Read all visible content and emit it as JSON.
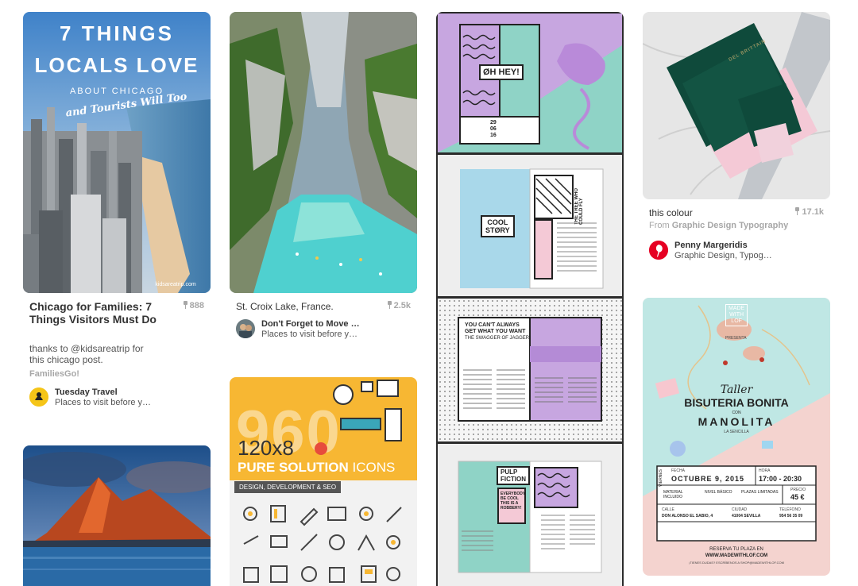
{
  "pins": [
    {
      "image_text": {
        "line1": "7 THINGS",
        "line2": "LOCALS LOVE",
        "line3": "ABOUT CHICAGO",
        "line4": "and Tourists Will Too",
        "credit": "kidsareatrip.com"
      },
      "title": "Chicago for Families: 7 Things Visitors Must Do",
      "saves": "888",
      "description": "thanks to @kidsareatrip for this chicago post.",
      "source": "FamiliesGo!",
      "user": "Tuesday Travel",
      "board": "Places to visit before y…"
    },
    {
      "title": "St. Croix Lake, France.",
      "saves": "2.5k",
      "user": "Don't Forget to Move …",
      "board": "Places to visit before y…"
    },
    {
      "image_text": {
        "big": "960",
        "size": "120x8",
        "line": "PURE SOLUTION",
        "icons": "ICONS",
        "tag": "DESIGN, DEVELOPMENT & SEO"
      }
    },
    {
      "image_text": {
        "hey": "ØH HEY!",
        "date1": "29",
        "date2": "06",
        "date3": "16",
        "cool1": "COOL",
        "cool2": "STØRY",
        "tree": "THE TREE WHO COULD FLY",
        "want1": "YOU CAN'T ALWAYS",
        "want2": "GET WHAT YOU WANT",
        "want3": "THE SWAGGER OF JAGGER",
        "pulp1": "PULP",
        "pulp2": "FICTION",
        "robbery": "EVERYBODY BE COOL THIS IS A ROBBERY!"
      }
    },
    {
      "image_text": {
        "brand": "DEL BRITTAIN"
      },
      "title": "this colour",
      "saves": "17.1k",
      "source_prefix": "From",
      "source": "Graphic Design Typography",
      "user": "Penny Margeridis",
      "board": "Graphic Design, Typog…"
    },
    {
      "image_text": {
        "made1": "MADE",
        "made2": "WITH",
        "made3": "LOF",
        "presenta": "PRESENTA",
        "taller": "Taller",
        "bisuteria": "BISUTERIA BONITA",
        "con": "CON",
        "manolita": "MANOLITA",
        "sencilla": "LA SENCILLA",
        "viernes": "VIERNES",
        "fecha_label": "FECHA",
        "fecha": "OCTUBRE 9, 2015",
        "hora_label": "HORA",
        "hora": "17:00 - 20:30",
        "material": "MATERIAL INCLUIDO",
        "nivel": "NIVEL BÁSICO",
        "plazas": "PLAZAS LIMITADAS",
        "precio_label": "PRECIO",
        "precio": "45 €",
        "calle_label": "CALLE",
        "calle": "DON ALONSO EL SABIO, 4",
        "ciudad_label": "CIUDAD",
        "ciudad": "41004 SEVILLA",
        "telefono_label": "TELÉFONO",
        "telefono": "954 56 35 09",
        "reserva1": "RESERVA TU PLAZA EN",
        "reserva2": "WWW.MADEWITHLOF.COM",
        "reserva3": "¡TIENES DUDAS? ESCRÍBENOS A SHOP@MADEWITHLOF.COM"
      }
    }
  ],
  "colors": {
    "accent_red": "#e60023",
    "text": "#333333",
    "muted": "#a7a7a7",
    "green_envelope": "#0f4a3b",
    "pink": "#f4c9d6",
    "mint": "#8fd3c6",
    "lilac": "#c7a6e0"
  }
}
